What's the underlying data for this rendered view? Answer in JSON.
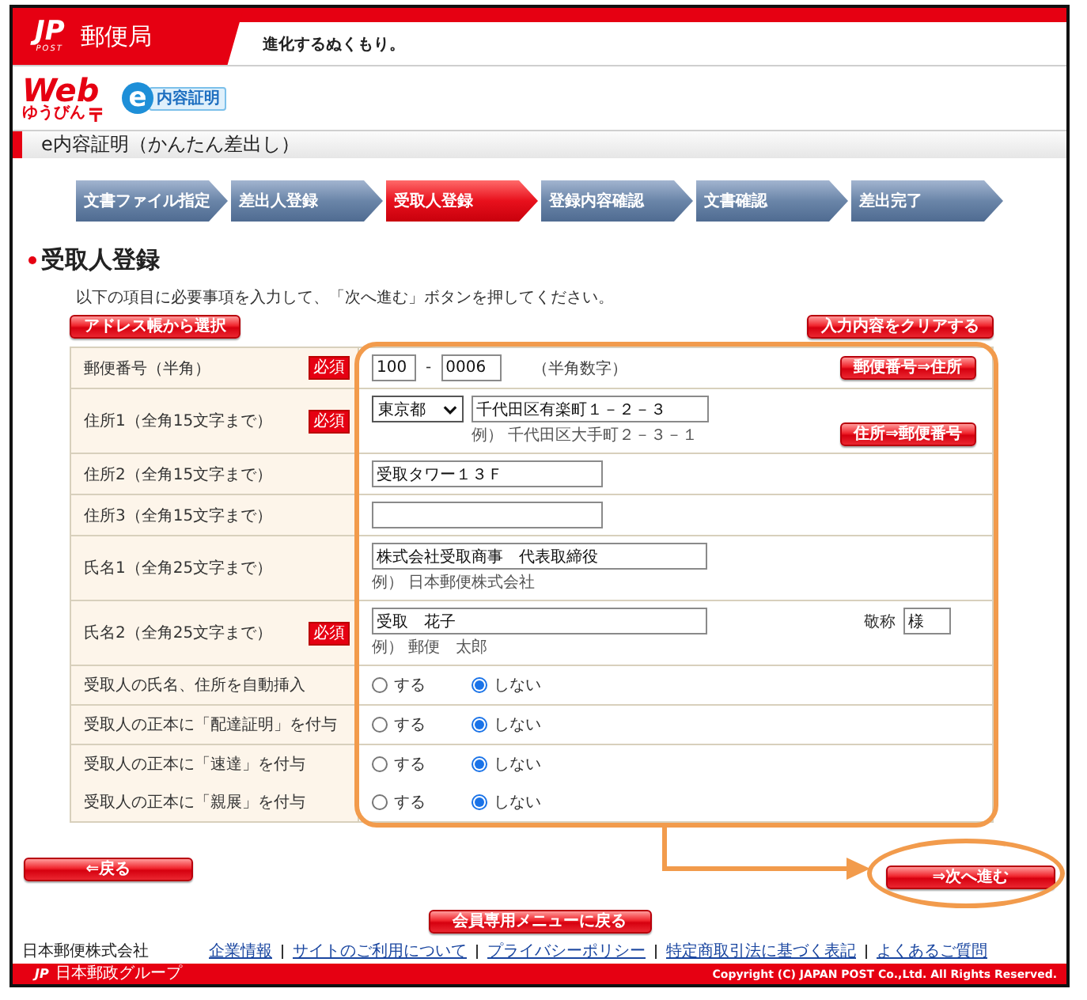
{
  "header": {
    "logo_mark": "JP",
    "logo_sub": "POST",
    "brand": "郵便局",
    "slogan": "進化するぬくもり。"
  },
  "service_logos": {
    "web": "Web",
    "web_sub": "ゆうびん",
    "e_mark": "e",
    "e_text": "内容証明"
  },
  "page_title": "e内容証明（かんたん差出し）",
  "steps": [
    {
      "label": "文書ファイル指定",
      "selected": false
    },
    {
      "label": "差出人登録",
      "selected": false
    },
    {
      "label": "受取人登録",
      "selected": true
    },
    {
      "label": "登録内容確認",
      "selected": false
    },
    {
      "label": "文書確認",
      "selected": false
    },
    {
      "label": "差出完了",
      "selected": false
    }
  ],
  "heading": "受取人登録",
  "instruction": "以下の項目に必要事項を入力して、「次へ進む」ボタンを押してください。",
  "top_buttons": [
    "アドレス帳から選択",
    "入力内容をクリアする"
  ],
  "form": {
    "rows": [
      {
        "kind": "postal",
        "label": "郵便番号（半角）",
        "badge": "必須",
        "code_first": "100",
        "code_separator": "-",
        "code_last": "0006",
        "hint": "（半角数字）",
        "button": "郵便番号⇒住所"
      },
      {
        "kind": "address",
        "label": "住所1（全角15文字まで）",
        "badge": "必須",
        "prefecture": "東京都",
        "value": "千代田区有楽町１－２－３",
        "example": "例） 千代田区大手町２－３－１",
        "button": "住所⇒郵便番号"
      },
      {
        "kind": "address_line",
        "label": "住所2（全角15文字まで）",
        "value": "受取タワー１３Ｆ"
      },
      {
        "kind": "address_line",
        "label": "住所3（全角15文字まで）"
      },
      {
        "kind": "name",
        "label": "氏名1（全角25文字まで）",
        "value": "株式会社受取商事　代表取締役",
        "example": "例） 日本郵便株式会社"
      },
      {
        "kind": "name",
        "label": "氏名2（全角25文字まで）",
        "badge": "必須",
        "value": "受取　花子",
        "example": "例） 郵便　太郎",
        "honorific_label": "敬称",
        "honorific": "様"
      },
      {
        "kind": "options",
        "items": [
          {
            "label": "受取人の氏名、住所を自動挿入",
            "choices": [
              {
                "label": "する",
                "selected": false
              },
              {
                "label": "しない",
                "selected": true
              }
            ]
          }
        ]
      },
      {
        "kind": "options",
        "items": [
          {
            "label": "受取人の正本に「配達証明」を付与",
            "choices": [
              {
                "label": "する",
                "selected": false
              },
              {
                "label": "しない",
                "selected": true
              }
            ]
          }
        ]
      },
      {
        "kind": "options",
        "items": [
          {
            "label": "受取人の正本に「速達」を付与",
            "choices": [
              {
                "label": "する",
                "selected": false
              },
              {
                "label": "しない",
                "selected": true
              }
            ]
          },
          {
            "label": "受取人の正本に「親展」を付与",
            "choices": [
              {
                "label": "する",
                "selected": false
              },
              {
                "label": "しない",
                "selected": true
              }
            ]
          }
        ]
      }
    ]
  },
  "back_button": "⇐戻る",
  "next_button": "⇒次へ進む",
  "menu_button": "会員専用メニューに戻る",
  "footer": {
    "company": "日本郵便株式会社",
    "links": [
      "企業情報",
      "サイトのご利用について",
      "プライバシーポリシー",
      "特定商取引法に基づく表記",
      "よくあるご質問"
    ],
    "group_mark": "JP",
    "group_name": "日本郵政グループ",
    "copyright": "Copyright (C) JAPAN POST Co.,Ltd. All Rights Reserved."
  }
}
